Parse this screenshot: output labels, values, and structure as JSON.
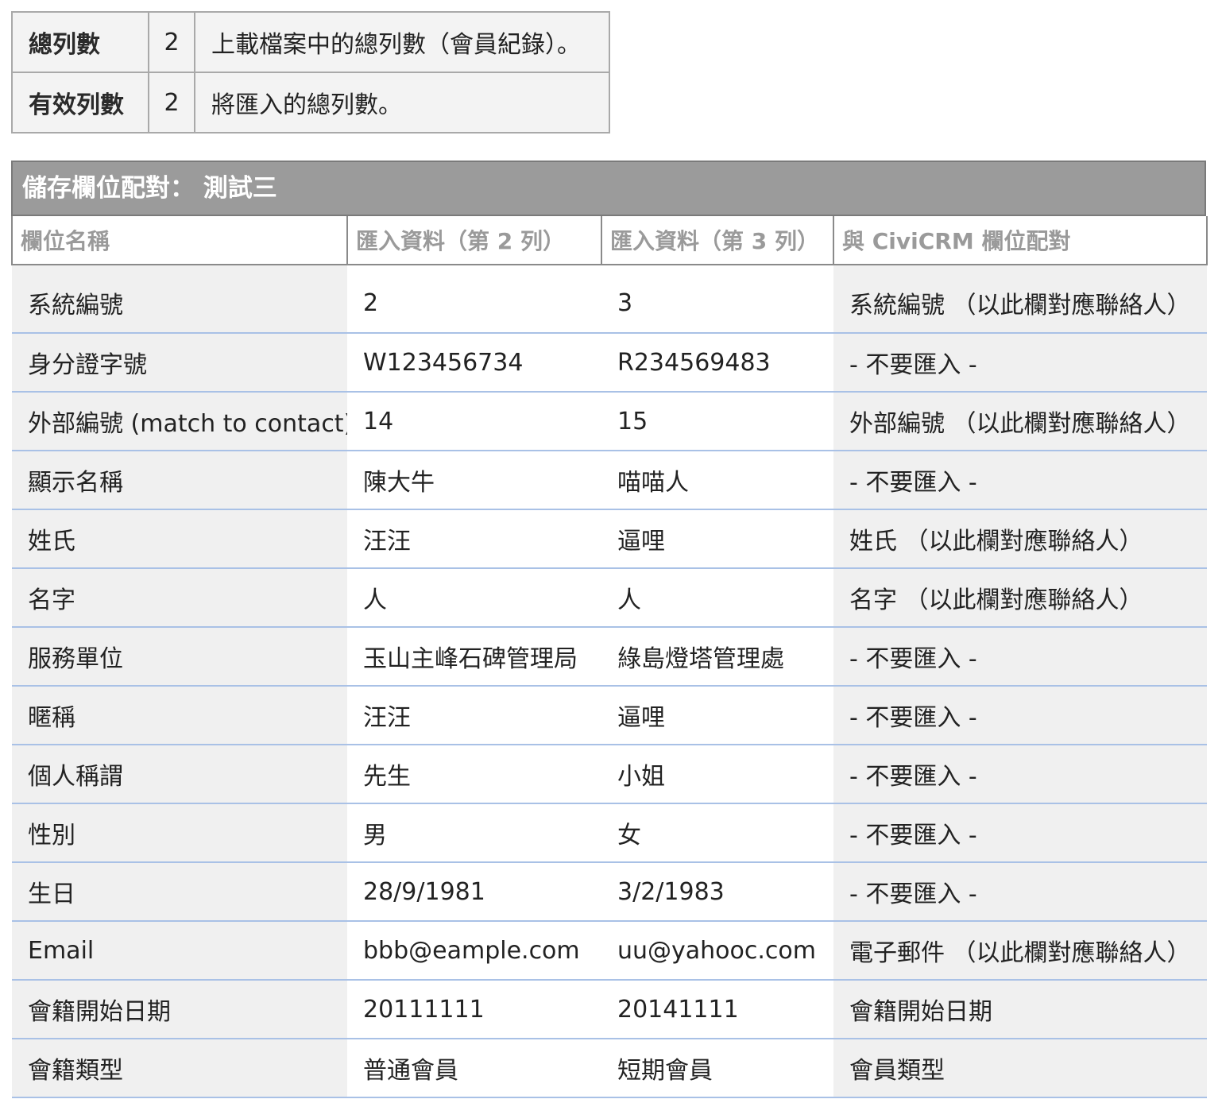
{
  "summary": {
    "rows": [
      {
        "label": "總列數",
        "value": "2",
        "desc": "上載檔案中的總列數（會員紀錄）。"
      },
      {
        "label": "有效列數",
        "value": "2",
        "desc": "將匯入的總列數。"
      }
    ]
  },
  "mapping": {
    "title": "儲存欄位配對：  測試三",
    "headers": {
      "field_name": "欄位名稱",
      "row2": "匯入資料（第 2 列）",
      "row3": "匯入資料（第 3 列）",
      "civicrm": "與 CiviCRM 欄位配對"
    },
    "rows": [
      {
        "field": "系統編號",
        "row2": "2",
        "row3": "3",
        "map": "系統編號 （以此欄對應聯絡人）"
      },
      {
        "field": "身分證字號",
        "row2": "W123456734",
        "row3": "R234569483",
        "map": "- 不要匯入 -"
      },
      {
        "field": "外部編號 (match to contact)",
        "row2": "14",
        "row3": "15",
        "map": "外部編號 （以此欄對應聯絡人）"
      },
      {
        "field": "顯示名稱",
        "row2": "陳大牛",
        "row3": "喵喵人",
        "map": "- 不要匯入 -"
      },
      {
        "field": "姓氏",
        "row2": "汪汪",
        "row3": "逼哩",
        "map": "姓氏 （以此欄對應聯絡人）"
      },
      {
        "field": "名字",
        "row2": "人",
        "row3": "人",
        "map": "名字 （以此欄對應聯絡人）"
      },
      {
        "field": "服務單位",
        "row2": "玉山主峰石碑管理局",
        "row3": "綠島燈塔管理處",
        "map": "- 不要匯入 -"
      },
      {
        "field": "暱稱",
        "row2": "汪汪",
        "row3": "逼哩",
        "map": "- 不要匯入 -"
      },
      {
        "field": "個人稱謂",
        "row2": "先生",
        "row3": "小姐",
        "map": "- 不要匯入 -"
      },
      {
        "field": "性別",
        "row2": "男",
        "row3": "女",
        "map": "- 不要匯入 -"
      },
      {
        "field": "生日",
        "row2": "28/9/1981",
        "row3": "3/2/1983",
        "map": "- 不要匯入 -"
      },
      {
        "field": "Email",
        "row2": "bbb@eample.com",
        "row3": "uu@yahooc.com",
        "map": "電子郵件 （以此欄對應聯絡人）"
      },
      {
        "field": "會籍開始日期",
        "row2": "20111111",
        "row3": "20141111",
        "map": "會籍開始日期"
      },
      {
        "field": "會籍類型",
        "row2": "普通會員",
        "row3": "短期會員",
        "map": "會員類型"
      }
    ]
  }
}
